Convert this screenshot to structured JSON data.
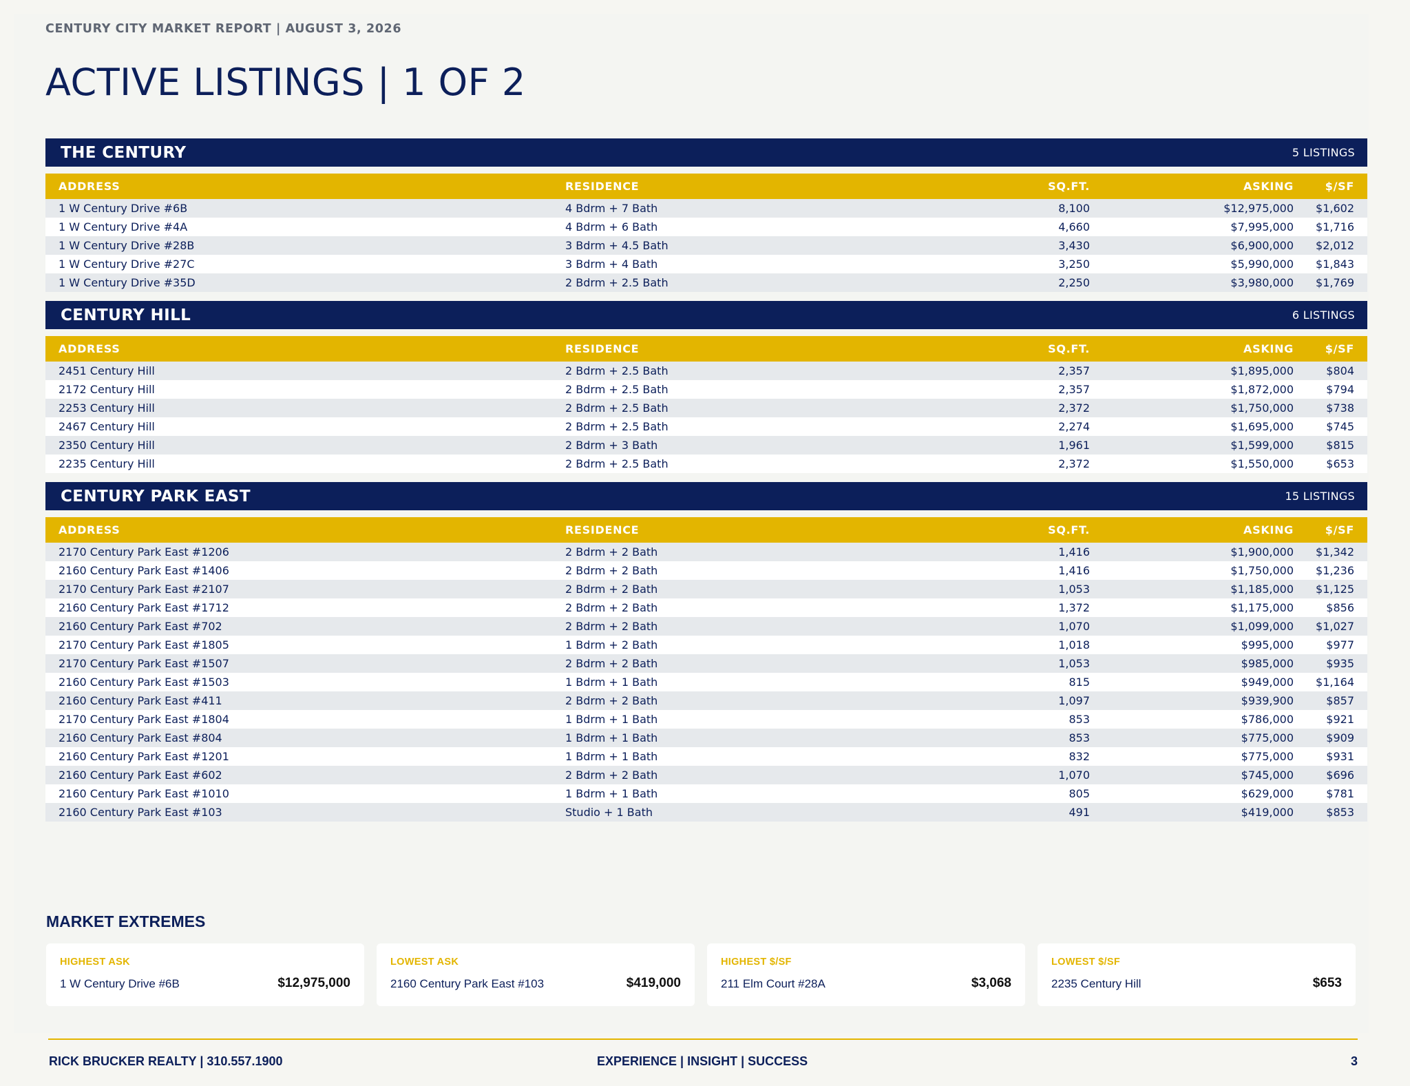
{
  "header": {
    "kicker": "CENTURY CITY MARKET REPORT | AUGUST 3, 2026",
    "title": "ACTIVE LISTINGS | 1 OF 2"
  },
  "columns": {
    "address": "ADDRESS",
    "residence": "RESIDENCE",
    "sqft": "SQ.FT.",
    "asking": "ASKING",
    "psf": "$/SF"
  },
  "sections": [
    {
      "name": "THE CENTURY",
      "count": "5 LISTINGS",
      "rows": [
        [
          "1 W Century Drive #6B",
          "4 Bdrm + 7 Bath",
          "8,100",
          "$12,975,000",
          "$1,602"
        ],
        [
          "1 W Century Drive #4A",
          "4 Bdrm + 6 Bath",
          "4,660",
          "$7,995,000",
          "$1,716"
        ],
        [
          "1 W Century Drive #28B",
          "3 Bdrm + 4.5 Bath",
          "3,430",
          "$6,900,000",
          "$2,012"
        ],
        [
          "1 W Century Drive #27C",
          "3 Bdrm + 4 Bath",
          "3,250",
          "$5,990,000",
          "$1,843"
        ],
        [
          "1 W Century Drive #35D",
          "2 Bdrm + 2.5 Bath",
          "2,250",
          "$3,980,000",
          "$1,769"
        ]
      ]
    },
    {
      "name": "CENTURY HILL",
      "count": "6 LISTINGS",
      "rows": [
        [
          "2451 Century Hill",
          "2 Bdrm + 2.5 Bath",
          "2,357",
          "$1,895,000",
          "$804"
        ],
        [
          "2172 Century Hill",
          "2 Bdrm + 2.5 Bath",
          "2,357",
          "$1,872,000",
          "$794"
        ],
        [
          "2253 Century Hill",
          "2 Bdrm + 2.5 Bath",
          "2,372",
          "$1,750,000",
          "$738"
        ],
        [
          "2467 Century Hill",
          "2 Bdrm + 2.5 Bath",
          "2,274",
          "$1,695,000",
          "$745"
        ],
        [
          "2350 Century Hill",
          "2 Bdrm + 3 Bath",
          "1,961",
          "$1,599,000",
          "$815"
        ],
        [
          "2235 Century Hill",
          "2 Bdrm + 2.5 Bath",
          "2,372",
          "$1,550,000",
          "$653"
        ]
      ]
    },
    {
      "name": "CENTURY PARK EAST",
      "count": "15 LISTINGS",
      "rows": [
        [
          "2170 Century Park East #1206",
          "2 Bdrm + 2 Bath",
          "1,416",
          "$1,900,000",
          "$1,342"
        ],
        [
          "2160 Century Park East #1406",
          "2 Bdrm + 2 Bath",
          "1,416",
          "$1,750,000",
          "$1,236"
        ],
        [
          "2170 Century Park East #2107",
          "2 Bdrm + 2 Bath",
          "1,053",
          "$1,185,000",
          "$1,125"
        ],
        [
          "2160 Century Park East #1712",
          "2 Bdrm + 2 Bath",
          "1,372",
          "$1,175,000",
          "$856"
        ],
        [
          "2160 Century Park East #702",
          "2 Bdrm + 2 Bath",
          "1,070",
          "$1,099,000",
          "$1,027"
        ],
        [
          "2170 Century Park East #1805",
          "1 Bdrm + 2 Bath",
          "1,018",
          "$995,000",
          "$977"
        ],
        [
          "2170 Century Park East #1507",
          "2 Bdrm + 2 Bath",
          "1,053",
          "$985,000",
          "$935"
        ],
        [
          "2160 Century Park East #1503",
          "1 Bdrm + 1 Bath",
          "815",
          "$949,000",
          "$1,164"
        ],
        [
          "2160 Century Park East #411",
          "2 Bdrm + 2 Bath",
          "1,097",
          "$939,900",
          "$857"
        ],
        [
          "2170 Century Park East #1804",
          "1 Bdrm + 1 Bath",
          "853",
          "$786,000",
          "$921"
        ],
        [
          "2160 Century Park East #804",
          "1 Bdrm + 1 Bath",
          "853",
          "$775,000",
          "$909"
        ],
        [
          "2160 Century Park East #1201",
          "1 Bdrm + 1 Bath",
          "832",
          "$775,000",
          "$931"
        ],
        [
          "2160 Century Park East #602",
          "2 Bdrm + 2 Bath",
          "1,070",
          "$745,000",
          "$696"
        ],
        [
          "2160 Century Park East #1010",
          "1 Bdrm + 1 Bath",
          "805",
          "$629,000",
          "$781"
        ],
        [
          "2160 Century Park East #103",
          "Studio + 1 Bath",
          "491",
          "$419,000",
          "$853"
        ]
      ]
    }
  ],
  "extremes": {
    "title": "MARKET EXTREMES",
    "cards": [
      {
        "label": "HIGHEST ASK",
        "address": "1 W Century Drive #6B",
        "value": "$12,975,000"
      },
      {
        "label": "LOWEST ASK",
        "address": "2160 Century Park East #103",
        "value": "$419,000"
      },
      {
        "label": "HIGHEST $/SF",
        "address": "211 Elm Court #28A",
        "value": "$3,068"
      },
      {
        "label": "LOWEST $/SF",
        "address": "2235 Century Hill",
        "value": "$653"
      }
    ]
  },
  "footer": {
    "left": "RICK BRUCKER REALTY | 310.557.1900",
    "center": "EXPERIENCE | INSIGHT | SUCCESS",
    "page": "3"
  },
  "colors": {
    "navy": "#0c1f5a",
    "gold": "#e3b500",
    "row_alt": "#e6e9ec"
  }
}
